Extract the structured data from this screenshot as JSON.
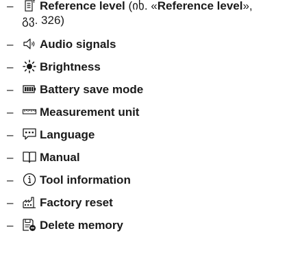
{
  "items": [
    {
      "id": "reference-level",
      "icon": "reference-level-icon",
      "label": "Reference level",
      "note_prefix": " (იხ. «",
      "note_bold": "Reference level",
      "note_suffix": "»,",
      "note_line2": "გვ. 326)"
    },
    {
      "id": "audio-signals",
      "icon": "speaker-icon",
      "label": "Audio signals"
    },
    {
      "id": "brightness",
      "icon": "sun-icon",
      "label": "Brightness"
    },
    {
      "id": "battery-save-mode",
      "icon": "battery-icon",
      "label": "Battery save mode"
    },
    {
      "id": "measurement-unit",
      "icon": "ruler-icon",
      "label": "Measurement unit"
    },
    {
      "id": "language",
      "icon": "speech-bubble-icon",
      "label": "Language"
    },
    {
      "id": "manual",
      "icon": "book-icon",
      "label": "Manual"
    },
    {
      "id": "tool-information",
      "icon": "info-icon",
      "label": "Tool information"
    },
    {
      "id": "factory-reset",
      "icon": "factory-icon",
      "label": "Factory reset"
    },
    {
      "id": "delete-memory",
      "icon": "delete-memory-icon",
      "label": "Delete memory"
    }
  ],
  "dash": "–"
}
